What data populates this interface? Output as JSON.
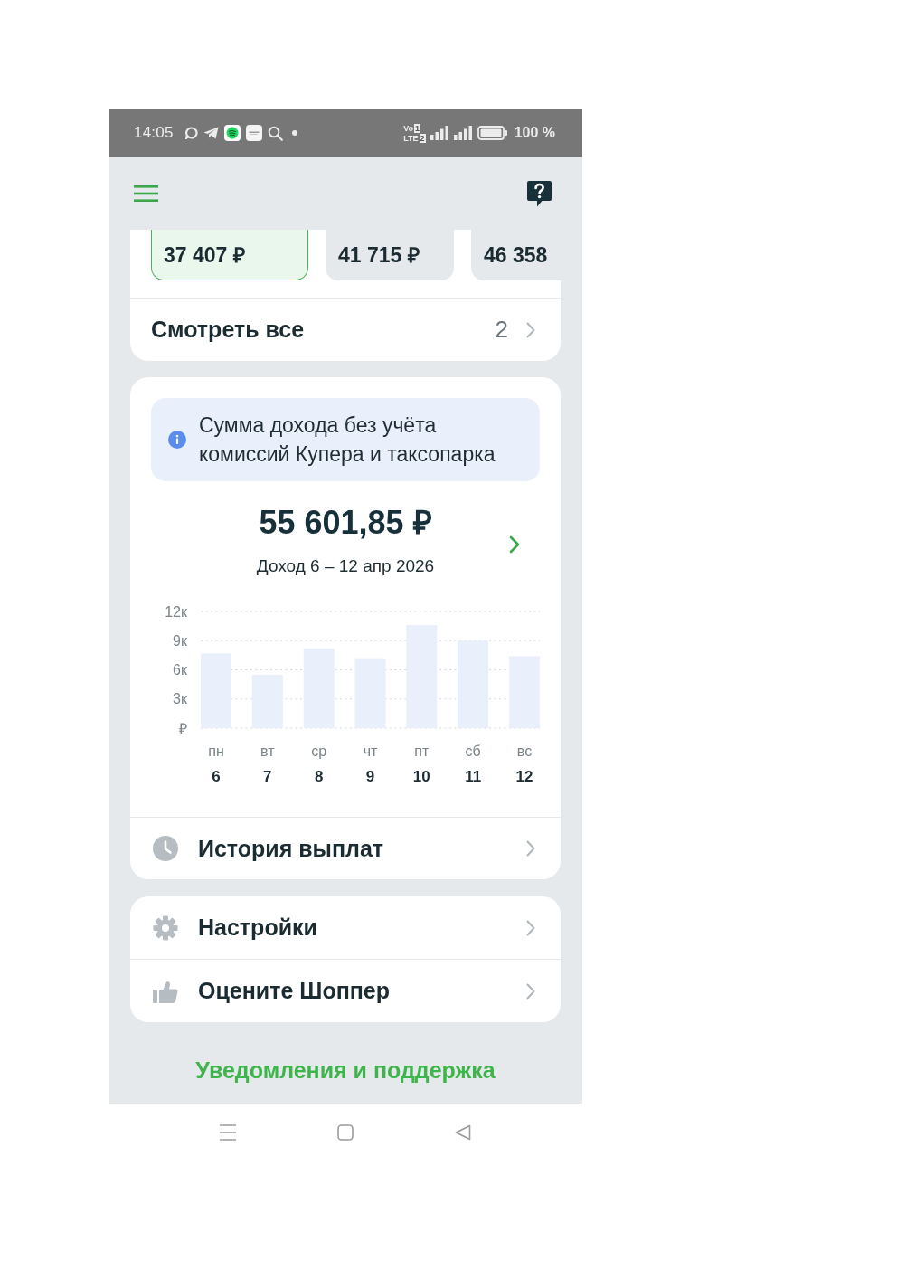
{
  "status_bar": {
    "time": "14:05",
    "volte": [
      {
        "label": "Vo",
        "sim": "1"
      },
      {
        "label": "LTE",
        "sim": "2"
      }
    ],
    "battery": "100 %"
  },
  "earnings_cards": [
    {
      "amount": "37 407 ₽",
      "selected": true
    },
    {
      "amount": "41 715 ₽",
      "selected": false
    },
    {
      "amount": "46 358",
      "selected": false
    }
  ],
  "see_all": {
    "label": "Смотреть все",
    "count": "2"
  },
  "income": {
    "notice": "Сумма дохода без учёта комиссий Купера и таксопарка",
    "total": "55 601,85 ₽",
    "period": "Доход 6 – 12 апр 2026",
    "chart_data": {
      "type": "bar",
      "categories": [
        "пн",
        "вт",
        "ср",
        "чт",
        "пт",
        "сб",
        "вс"
      ],
      "values": [
        7.7,
        5.5,
        8.2,
        7.2,
        10.6,
        9.0,
        7.4
      ],
      "ylim": [
        0,
        12
      ],
      "yticks": [
        {
          "value": 0,
          "label": "₽"
        },
        {
          "value": 3,
          "label": "3к"
        },
        {
          "value": 6,
          "label": "6к"
        },
        {
          "value": 9,
          "label": "9к"
        },
        {
          "value": 12,
          "label": "12к"
        }
      ],
      "grid": true
    },
    "dates": [
      "6",
      "7",
      "8",
      "9",
      "10",
      "11",
      "12"
    ],
    "link": {
      "label": "История выплат",
      "kind": "history"
    }
  },
  "menu": [
    {
      "label": "Настройки",
      "kind": "settings"
    },
    {
      "label": "Оцените Шоппер",
      "kind": "rate"
    }
  ],
  "support_link": "Уведомления и поддержка"
}
